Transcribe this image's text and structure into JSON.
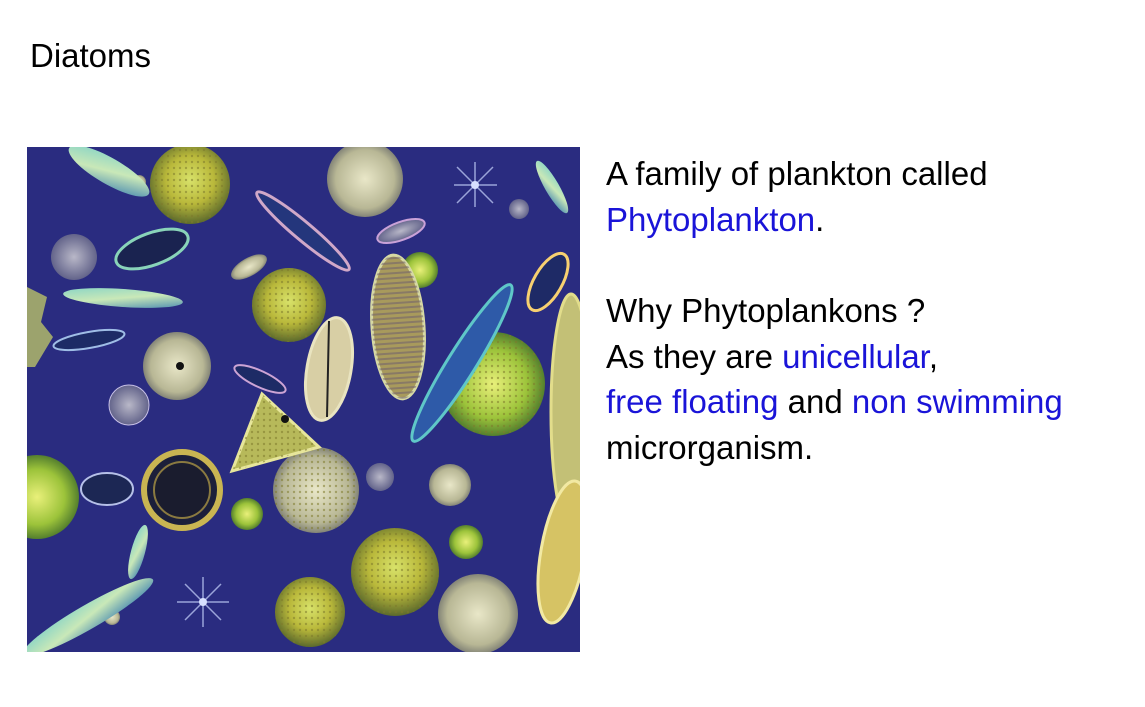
{
  "slide": {
    "title": "Diatoms",
    "paragraph1": {
      "text_a": "A family of plankton called",
      "term": "Phytoplankton",
      "term_suffix": "."
    },
    "paragraph2": {
      "question": "Why Phytoplankons ?",
      "as_they_are": "As they are",
      "unicellular": "unicellular",
      "comma": ",",
      "free_floating": "free floating",
      "and": "and",
      "non_swimming": "non swimming",
      "microrganism": "microrganism."
    },
    "colors": {
      "highlight": "#1a14d8",
      "photo_background": "#2b2f86"
    }
  }
}
